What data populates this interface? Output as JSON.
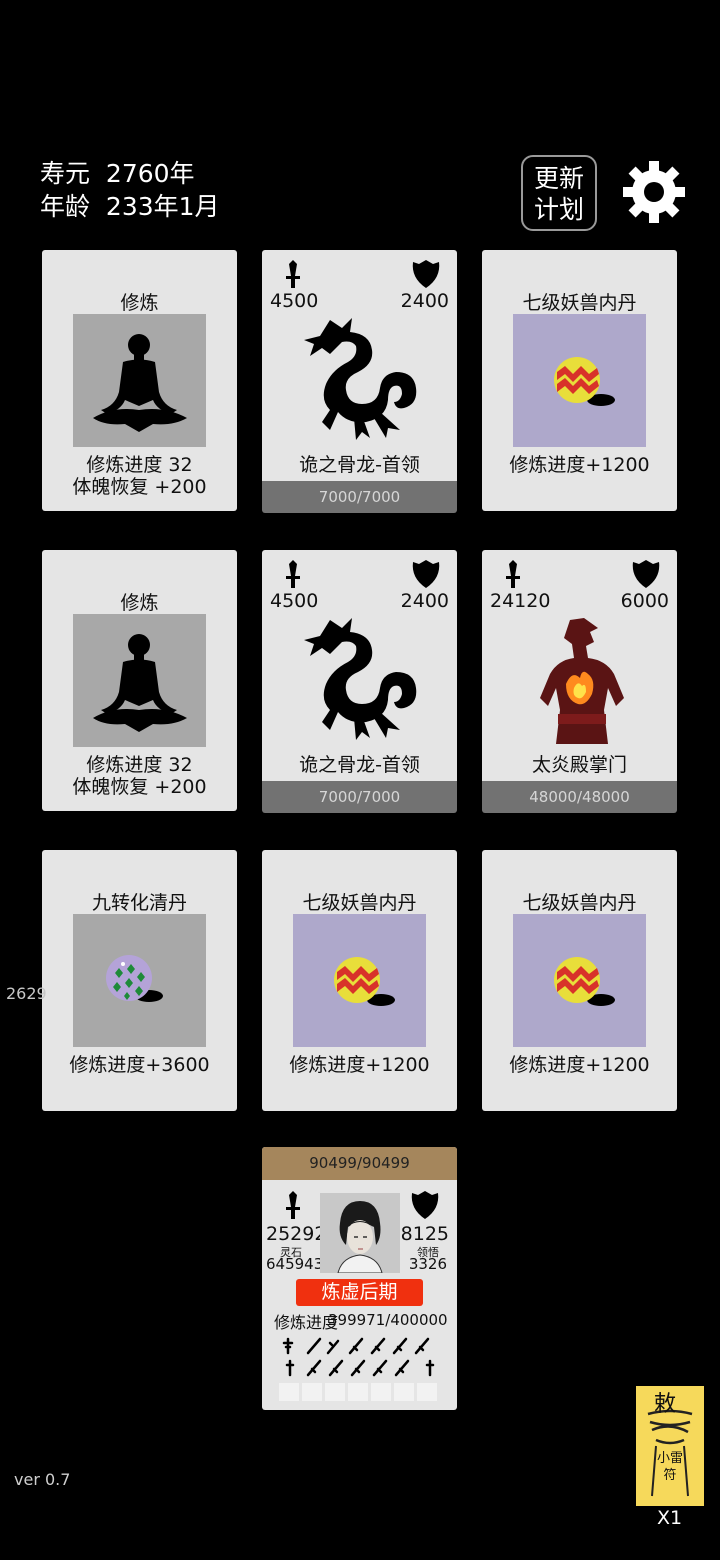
{
  "status": {
    "lifespan_label": "寿元",
    "lifespan_value": "2760年",
    "age_label": "年龄",
    "age_value": "233年1月"
  },
  "header": {
    "update_button_line1": "更新",
    "update_button_line2": "计划",
    "settings_icon": "gear-icon"
  },
  "cards": {
    "r1c1": {
      "type": "cultivate",
      "title": "修炼",
      "line1": "修炼进度  32",
      "line2": "体魄恢复  +200",
      "icon": "meditation-icon"
    },
    "r1c2": {
      "type": "enemy",
      "attack": "4500",
      "defense": "2400",
      "name": "诡之骨龙-首领",
      "hp": "7000/7000",
      "icon": "bone-dragon-icon"
    },
    "r1c3": {
      "type": "item",
      "title": "七级妖兽内丹",
      "effect": "修炼进度+1200",
      "icon": "beast-core-icon"
    },
    "r2c1": {
      "type": "cultivate",
      "title": "修炼",
      "line1": "修炼进度  32",
      "line2": "体魄恢复  +200",
      "icon": "meditation-icon"
    },
    "r2c2": {
      "type": "enemy",
      "attack": "4500",
      "defense": "2400",
      "name": "诡之骨龙-首领",
      "hp": "7000/7000",
      "icon": "bone-dragon-icon"
    },
    "r2c3": {
      "type": "enemy",
      "attack": "24120",
      "defense": "6000",
      "name": "太炎殿掌门",
      "hp": "48000/48000",
      "icon": "flame-master-icon"
    },
    "r3c1": {
      "type": "item",
      "title": "九转化清丹",
      "effect": "修炼进度+3600",
      "icon": "pill-icon"
    },
    "r3c2": {
      "type": "item",
      "title": "七级妖兽内丹",
      "effect": "修炼进度+1200",
      "icon": "beast-core-icon"
    },
    "r3c3": {
      "type": "item",
      "title": "七级妖兽内丹",
      "effect": "修炼进度+1200",
      "icon": "beast-core-icon"
    }
  },
  "side_counter": "2629",
  "player": {
    "hp": "90499/90499",
    "attack": "25292",
    "defense": "8125",
    "spirit_stone_label": "灵石",
    "spirit_stone_value": "645943",
    "comprehension_label": "领悟",
    "comprehension_value": "3326",
    "realm": "炼虚后期",
    "progress_label": "修炼进度",
    "progress_value": "399971/400000"
  },
  "talisman": {
    "text_top": "敕",
    "text_bottom": "小雷符",
    "count": "X1"
  },
  "version": "ver 0.7"
}
